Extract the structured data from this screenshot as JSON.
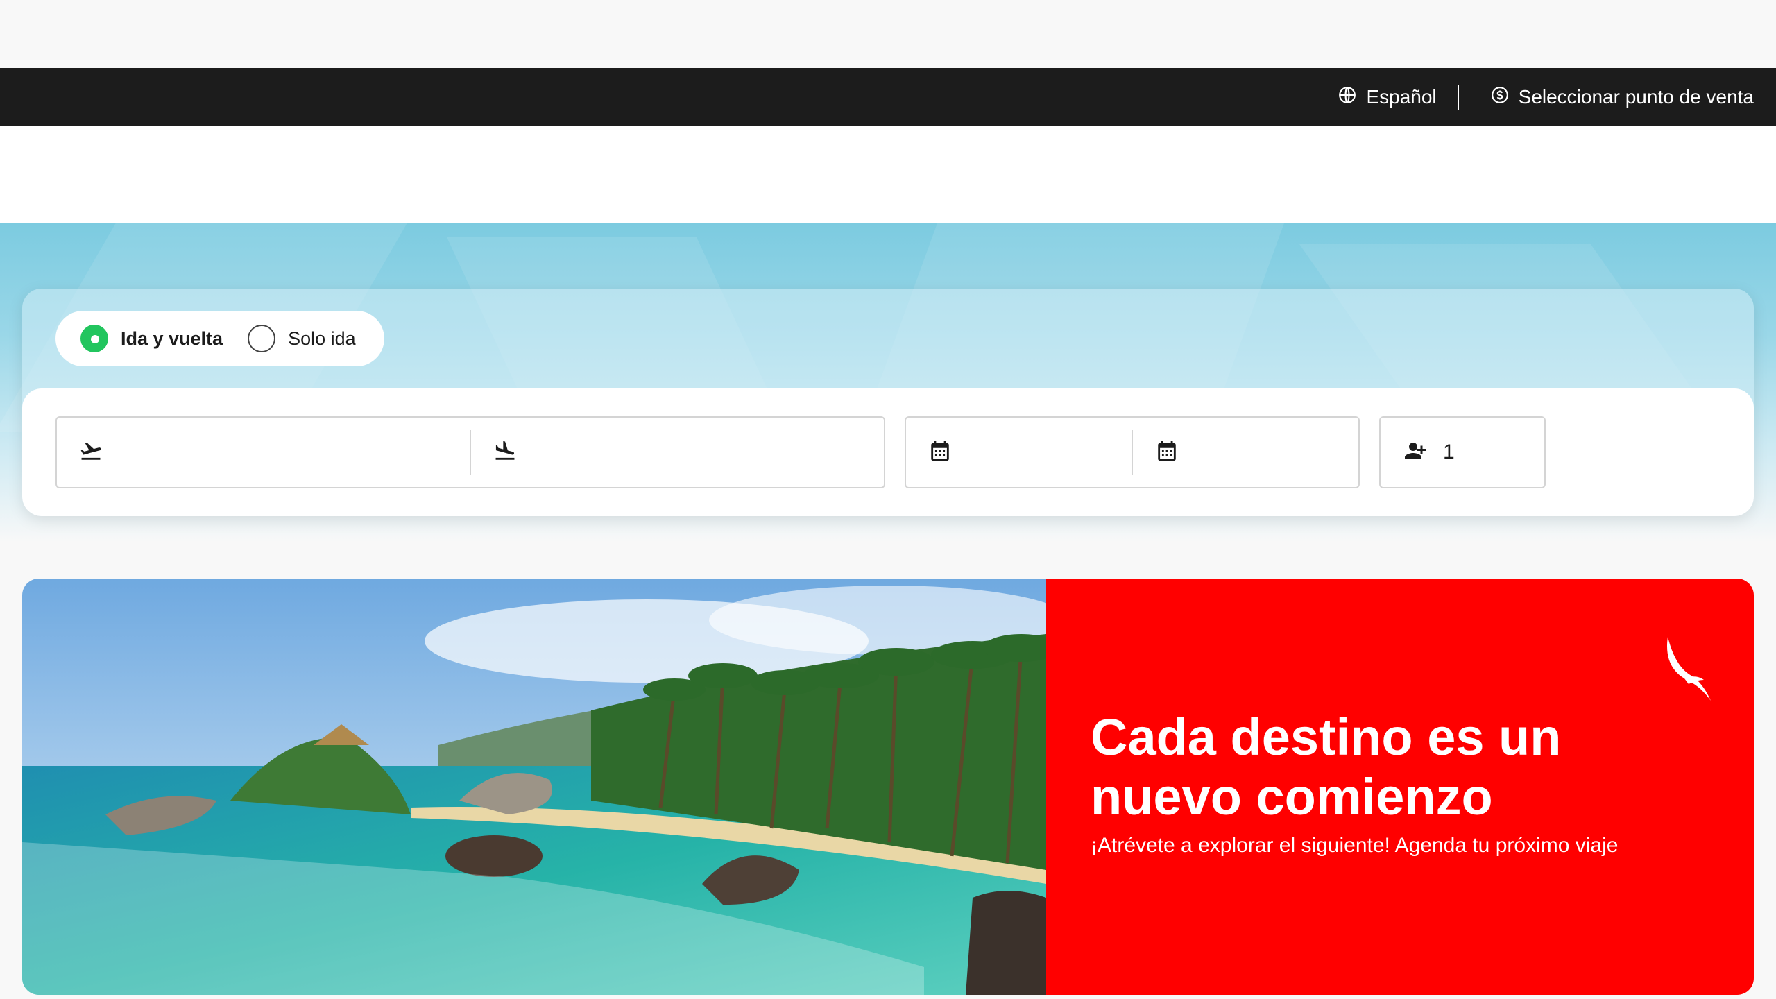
{
  "topbar": {
    "language_label": "Español",
    "language_icon": "globe-icon",
    "point_of_sale_label": "Seleccionar punto de venta",
    "point_of_sale_icon": "currency-icon"
  },
  "search": {
    "trip_types": [
      {
        "label": "Ida y vuelta",
        "selected": true
      },
      {
        "label": "Solo ida",
        "selected": false
      }
    ],
    "origin_icon": "takeoff-icon",
    "destination_icon": "landing-icon",
    "departure_date_icon": "calendar-icon",
    "return_date_icon": "calendar-icon",
    "passengers_icon": "add-person-icon",
    "passengers_value": "1"
  },
  "promo": {
    "title_line1": "Cada destino es un",
    "title_line2": "nuevo comienzo",
    "subtitle": "¡Atrévete a explorar el siguiente! Agenda tu próximo viaje",
    "logo": "bird-logo"
  },
  "colors": {
    "topbar_bg": "#1c1c1c",
    "radio_selected": "#22c55e",
    "promo_red": "#ff0000",
    "hero_blue": "#7ccbe0"
  }
}
